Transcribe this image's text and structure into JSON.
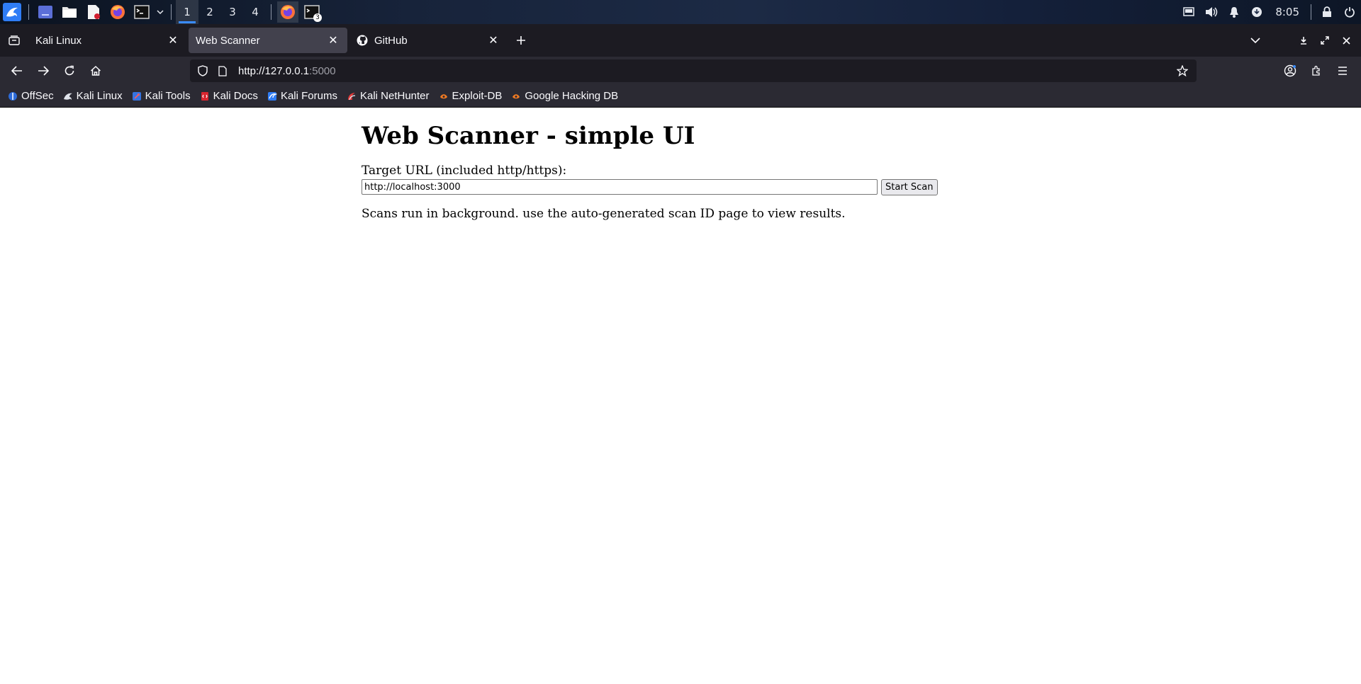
{
  "taskbar": {
    "workspaces": [
      "1",
      "2",
      "3",
      "4"
    ],
    "active_workspace": "1",
    "terminal_badge": "3",
    "clock": "8:05",
    "accent_color": "#3a8cff"
  },
  "browser": {
    "tabs": [
      {
        "title": "Kali Linux",
        "icon": "kali-dragon-icon",
        "active": false
      },
      {
        "title": "Web Scanner",
        "icon": "",
        "active": true
      },
      {
        "title": "GitHub",
        "icon": "github-icon",
        "active": false
      }
    ],
    "url": {
      "host": "http://127.0.0.1",
      "port": ":5000"
    },
    "bookmarks": [
      {
        "label": "OffSec",
        "icon": "offsec-icon"
      },
      {
        "label": "Kali Linux",
        "icon": "kali-dragon-icon"
      },
      {
        "label": "Kali Tools",
        "icon": "kali-tools-icon"
      },
      {
        "label": "Kali Docs",
        "icon": "kali-docs-icon"
      },
      {
        "label": "Kali Forums",
        "icon": "kali-forums-icon"
      },
      {
        "label": "Kali NetHunter",
        "icon": "nethunter-icon"
      },
      {
        "label": "Exploit-DB",
        "icon": "exploit-db-icon"
      },
      {
        "label": "Google Hacking DB",
        "icon": "ghdb-icon"
      }
    ]
  },
  "page": {
    "title": "Web Scanner - simple UI",
    "target_label": "Target URL (included http/https):",
    "target_value": "http://localhost:3000",
    "start_button": "Start Scan",
    "hint": "Scans run in background. use the auto-generated scan ID page to view results."
  }
}
